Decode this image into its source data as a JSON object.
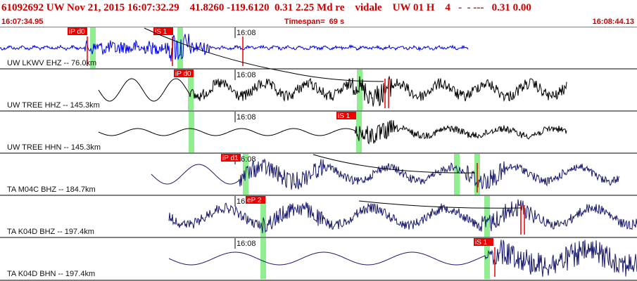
{
  "header": {
    "title": "61092692 UW Nov 21, 2015 16:07:32.29    41.8260 -119.6120  0.31 2.25 Md re    vidale    UW 01 H    4   -  - ---   0.31 0.00",
    "start_time": "16:07:34.95",
    "timespan": "Timespan=  69 s",
    "end_time": "16:08:44.13"
  },
  "colors": {
    "blue_trace": "#0000ee",
    "trace": "#000000",
    "navy_trace": "#1a1a6e",
    "pick": "#ee0000",
    "window": "#90ee90",
    "title_text": "#cc0000"
  },
  "traces": [
    {
      "channel": "UW LKWV EHZ -- 76.0km",
      "time_label": "16:08",
      "picks": [
        "iP d0",
        "iS 1"
      ]
    },
    {
      "channel": "UW TREE HHZ -- 145.3km",
      "time_label": "16:08",
      "picks": [
        "iP d0"
      ]
    },
    {
      "channel": "UW TREE HHN -- 145.3km",
      "time_label": "16:08",
      "picks": [
        "iS 1"
      ]
    },
    {
      "channel": "TA M04C BHZ -- 184.7km",
      "time_label": "16:08",
      "picks": [
        "iP d1"
      ]
    },
    {
      "channel": "TA K04D BHZ -- 197.4km",
      "time_label": "16:08",
      "picks": [
        "eP 2"
      ]
    },
    {
      "channel": "TA K04D BHN -- 197.4km",
      "time_label": "16:08",
      "picks": [
        "iS 1"
      ]
    }
  ]
}
